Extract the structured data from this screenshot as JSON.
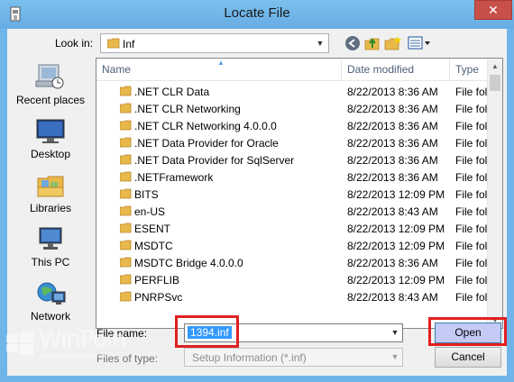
{
  "window": {
    "title": "Locate File",
    "close_glyph": "✕"
  },
  "toolbar": {
    "look_in_label": "Look in:",
    "look_in_value": "Inf",
    "icons": [
      "back-arrow-icon",
      "up-folder-icon",
      "new-folder-icon",
      "view-menu-icon"
    ]
  },
  "places": [
    {
      "label": "Recent places",
      "icon": "recent-places-icon"
    },
    {
      "label": "Desktop",
      "icon": "desktop-icon"
    },
    {
      "label": "Libraries",
      "icon": "libraries-icon"
    },
    {
      "label": "This PC",
      "icon": "this-pc-icon"
    },
    {
      "label": "Network",
      "icon": "network-icon"
    }
  ],
  "file_list": {
    "columns": [
      "Name",
      "Date modified",
      "Type"
    ],
    "rows": [
      {
        "name": ".NET CLR Data",
        "date": "8/22/2013 8:36 AM",
        "type": "File fol"
      },
      {
        "name": ".NET CLR Networking",
        "date": "8/22/2013 8:36 AM",
        "type": "File fol"
      },
      {
        "name": ".NET CLR Networking 4.0.0.0",
        "date": "8/22/2013 8:36 AM",
        "type": "File fol"
      },
      {
        "name": ".NET Data Provider for Oracle",
        "date": "8/22/2013 8:36 AM",
        "type": "File fol"
      },
      {
        "name": ".NET Data Provider for SqlServer",
        "date": "8/22/2013 8:36 AM",
        "type": "File fol"
      },
      {
        "name": ".NETFramework",
        "date": "8/22/2013 8:36 AM",
        "type": "File fol"
      },
      {
        "name": "BITS",
        "date": "8/22/2013 12:09 PM",
        "type": "File fol"
      },
      {
        "name": "en-US",
        "date": "8/22/2013 8:43 AM",
        "type": "File fol"
      },
      {
        "name": "ESENT",
        "date": "8/22/2013 12:09 PM",
        "type": "File fol"
      },
      {
        "name": "MSDTC",
        "date": "8/22/2013 12:09 PM",
        "type": "File fol"
      },
      {
        "name": "MSDTC Bridge 4.0.0.0",
        "date": "8/22/2013 8:36 AM",
        "type": "File fol"
      },
      {
        "name": "PERFLIB",
        "date": "8/22/2013 12:09 PM",
        "type": "File fol"
      },
      {
        "name": "PNRPSvc",
        "date": "8/22/2013 8:43 AM",
        "type": "File fol"
      }
    ]
  },
  "form": {
    "file_name_label": "File name:",
    "file_name_value": "1394.inf",
    "file_type_label": "Files of type:",
    "file_type_value": "Setup Information (*.inf)",
    "open_label": "Open",
    "cancel_label": "Cancel"
  },
  "watermark": {
    "text": "WinPoin",
    "subtext": "#1 Windows Portal Indonesia"
  },
  "colors": {
    "titlebar": "#6fb5ea",
    "close": "#c7504a",
    "highlight": "#e02020",
    "selection": "#3399ff"
  }
}
